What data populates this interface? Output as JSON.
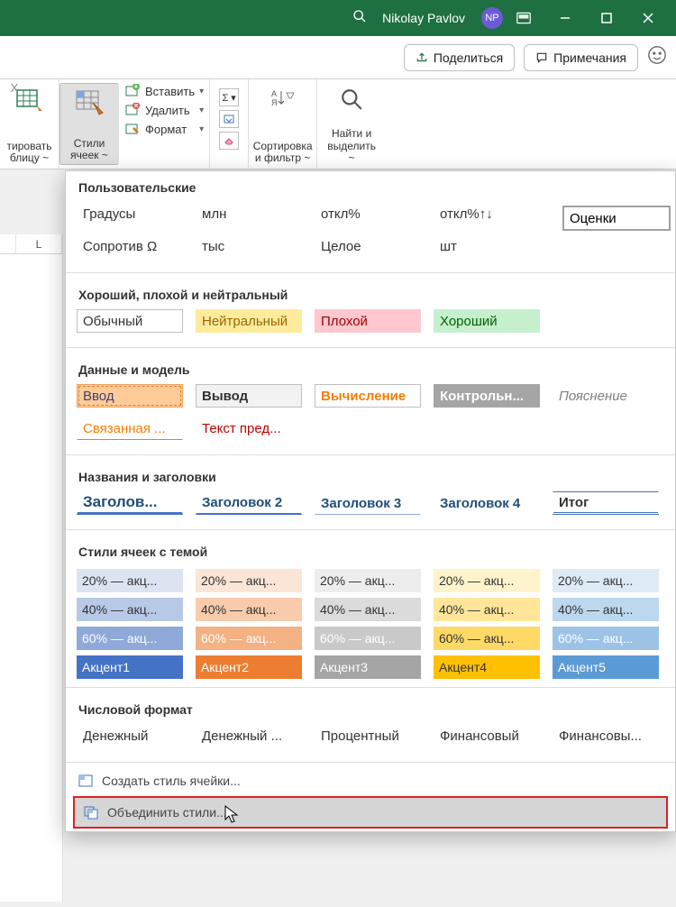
{
  "titlebar": {
    "user": "Nikolay Pavlov",
    "badge": "NP"
  },
  "actionrow": {
    "share": "Поделиться",
    "comments": "Примечания"
  },
  "ribbon": {
    "formatTable": "тировать\nблицу ~",
    "cellStyles": "Стили\nячеек ~",
    "insert": "Вставить",
    "delete": "Удалить",
    "format": "Формат",
    "sortFilter": "Сортировка\nи фильтр ~",
    "findSelect": "Найти и\nвыделить ~"
  },
  "fx_x": "X",
  "col_L": "L",
  "ocenki": "Оценки",
  "sections": {
    "custom": {
      "title": "Пользовательские",
      "r1": [
        "Градусы",
        "млн",
        "откл%",
        "откл%↑↓"
      ],
      "r2": [
        "Сопротив Ω",
        "тыс",
        "Целое",
        "шт"
      ]
    },
    "gbn": {
      "title": "Хороший, плохой и нейтральный",
      "items": [
        "Обычный",
        "Нейтральный",
        "Плохой",
        "Хороший"
      ]
    },
    "data": {
      "title": "Данные и модель",
      "r1": [
        "Ввод",
        "Вывод",
        "Вычисление",
        "Контрольн...",
        "Пояснение"
      ],
      "r2": [
        "Связанная ...",
        "Текст пред..."
      ]
    },
    "headings": {
      "title": "Названия и заголовки",
      "items": [
        "Заголов...",
        "Заголовок 2",
        "Заголовок 3",
        "Заголовок 4",
        "Итог"
      ]
    },
    "themed": {
      "title": "Стили ячеек с темой",
      "rows": [
        [
          {
            "t": "20% — акц...",
            "bg": "#dce4f2"
          },
          {
            "t": "20% — акц...",
            "bg": "#fbe5d6"
          },
          {
            "t": "20% — акц...",
            "bg": "#ededed"
          },
          {
            "t": "20% — акц...",
            "bg": "#fff3cc"
          },
          {
            "t": "20% — акц...",
            "bg": "#deeaf6"
          }
        ],
        [
          {
            "t": "40% — акц...",
            "bg": "#b7c9e6"
          },
          {
            "t": "40% — акц...",
            "bg": "#f8cbad"
          },
          {
            "t": "40% — акц...",
            "bg": "#dbdbdb"
          },
          {
            "t": "40% — акц...",
            "bg": "#ffe699"
          },
          {
            "t": "40% — акц...",
            "bg": "#bdd7ee"
          }
        ],
        [
          {
            "t": "60% — акц...",
            "bg": "#8fa9d9",
            "fg": "#fff"
          },
          {
            "t": "60% — акц...",
            "bg": "#f4b183",
            "fg": "#fff"
          },
          {
            "t": "60% — акц...",
            "bg": "#c9c9c9",
            "fg": "#fff"
          },
          {
            "t": "60% — акц...",
            "bg": "#ffd966"
          },
          {
            "t": "60% — акц...",
            "bg": "#9cc3e6",
            "fg": "#fff"
          }
        ],
        [
          {
            "t": "Акцент1",
            "bg": "#4472c4",
            "fg": "#fff"
          },
          {
            "t": "Акцент2",
            "bg": "#ed7d31",
            "fg": "#fff"
          },
          {
            "t": "Акцент3",
            "bg": "#a5a5a5",
            "fg": "#fff"
          },
          {
            "t": "Акцент4",
            "bg": "#ffc000"
          },
          {
            "t": "Акцент5",
            "bg": "#5b9bd5",
            "fg": "#fff"
          }
        ]
      ]
    },
    "number": {
      "title": "Числовой формат",
      "items": [
        "Денежный",
        "Денежный ...",
        "Процентный",
        "Финансовый",
        "Финансовы..."
      ]
    }
  },
  "actions": {
    "create": "Создать стиль ячейки...",
    "merge": "Объединить стили..."
  }
}
